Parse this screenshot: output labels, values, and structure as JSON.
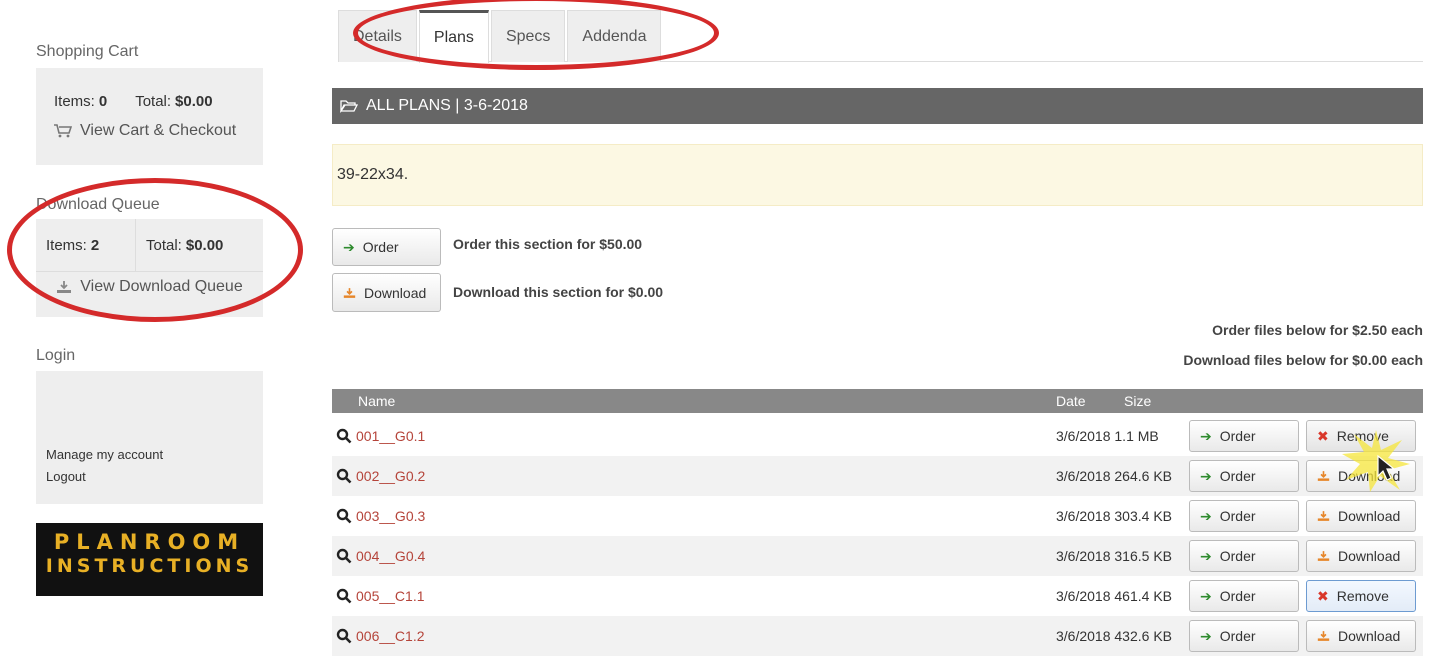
{
  "sidebar": {
    "cart": {
      "heading": "Shopping Cart",
      "items_label": "Items:",
      "items_value": "0",
      "total_label": "Total:",
      "total_value": "$0.00",
      "link": "View Cart & Checkout"
    },
    "queue": {
      "heading": "Download Queue",
      "items_label": "Items:",
      "items_value": "2",
      "total_label": "Total:",
      "total_value": "$0.00",
      "link": "View Download Queue"
    },
    "login": {
      "heading": "Login",
      "manage": "Manage my account",
      "logout": "Logout"
    },
    "logo": {
      "line1": "PLANROOM",
      "line2": "INSTRUCTIONS"
    }
  },
  "tabs": [
    "Details",
    "Plans",
    "Specs",
    "Addenda"
  ],
  "section": {
    "title": "ALL PLANS | 3-6-2018",
    "notice": "39-22x34."
  },
  "actions": {
    "order_btn": "Order",
    "order_text": "Order this section for $50.00",
    "download_btn": "Download",
    "download_text": "Download this section for $0.00",
    "order_each": "Order files below for $2.50 each",
    "download_each": "Download files below for $0.00 each"
  },
  "table": {
    "headers": {
      "name": "Name",
      "date": "Date",
      "size": "Size"
    },
    "rows": [
      {
        "name": "001__G0.1",
        "date": "3/6/2018",
        "size": "1.1 MB",
        "order": "Order",
        "action": "Remove"
      },
      {
        "name": "002__G0.2",
        "date": "3/6/2018",
        "size": "264.6 KB",
        "order": "Order",
        "action": "Download"
      },
      {
        "name": "003__G0.3",
        "date": "3/6/2018",
        "size": "303.4 KB",
        "order": "Order",
        "action": "Download"
      },
      {
        "name": "004__G0.4",
        "date": "3/6/2018",
        "size": "316.5 KB",
        "order": "Order",
        "action": "Download"
      },
      {
        "name": "005__C1.1",
        "date": "3/6/2018",
        "size": "461.4 KB",
        "order": "Order",
        "action": "Remove"
      },
      {
        "name": "006__C1.2",
        "date": "3/6/2018",
        "size": "432.6 KB",
        "order": "Order",
        "action": "Download"
      }
    ]
  },
  "colors": {
    "annotation": "#d42a2a",
    "link": "#b5443a",
    "bar": "#666666",
    "notice_bg": "#fcf8e3",
    "logo_text": "#e8b025"
  }
}
